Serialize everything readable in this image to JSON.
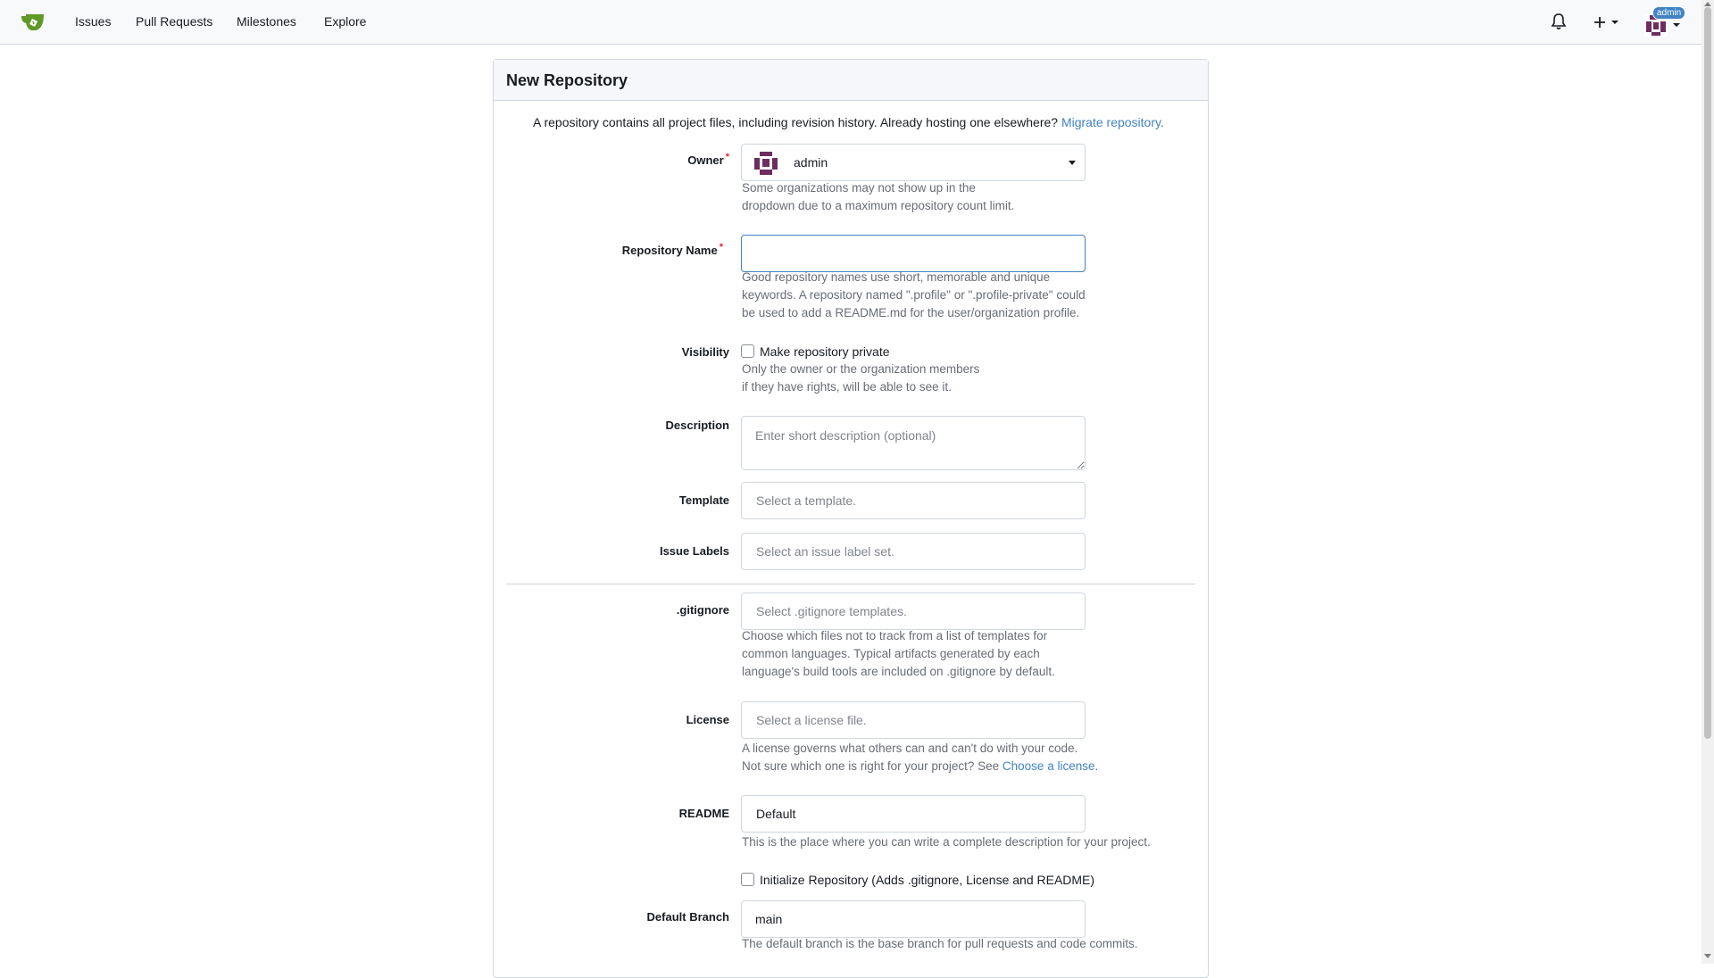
{
  "nav": {
    "items": [
      "Issues",
      "Pull Requests",
      "Milestones",
      "Explore"
    ],
    "user_badge": "admin"
  },
  "form": {
    "title": "New Repository",
    "intro_text": "A repository contains all project files, including revision history. Already hosting one elsewhere?",
    "intro_link": "Migrate repository.",
    "owner": {
      "label": "Owner",
      "value": "admin",
      "help": [
        "Some organizations may not show up in the",
        "dropdown due to a maximum repository count limit."
      ]
    },
    "repo_name": {
      "label": "Repository Name",
      "value": "",
      "help": [
        "Good repository names use short, memorable and unique",
        "keywords. A repository named \".profile\" or \".profile-private\" could",
        "be used to add a README.md for the user/organization profile."
      ]
    },
    "visibility": {
      "label": "Visibility",
      "checkbox_label": "Make repository private",
      "checked": false,
      "help": [
        "Only the owner or the organization members",
        "if they have rights, will be able to see it."
      ]
    },
    "description": {
      "label": "Description",
      "placeholder": "Enter short description (optional)"
    },
    "template": {
      "label": "Template",
      "placeholder": "Select a template."
    },
    "issue_labels": {
      "label": "Issue Labels",
      "placeholder": "Select an issue label set."
    },
    "gitignore": {
      "label": ".gitignore",
      "placeholder": "Select .gitignore templates.",
      "help": [
        "Choose which files not to track from a list of templates for",
        "common languages. Typical artifacts generated by each",
        "language's build tools are included on .gitignore by default."
      ]
    },
    "license": {
      "label": "License",
      "placeholder": "Select a license file.",
      "help_line1": "A license governs what others can and can't do with your code.",
      "help_line2": "Not sure which one is right for your project? See",
      "help_link": "Choose a license."
    },
    "readme": {
      "label": "README",
      "value": "Default",
      "help": "This is the place where you can write a complete description for your project."
    },
    "init": {
      "checkbox_label": "Initialize Repository (Adds .gitignore, License and README)",
      "checked": false
    },
    "default_branch": {
      "label": "Default Branch",
      "value": "main",
      "help": "The default branch is the base branch for pull requests and code commits."
    }
  },
  "colors": {
    "accent": "#4183c4",
    "required": "#db2828",
    "brand_green": "#609926"
  }
}
